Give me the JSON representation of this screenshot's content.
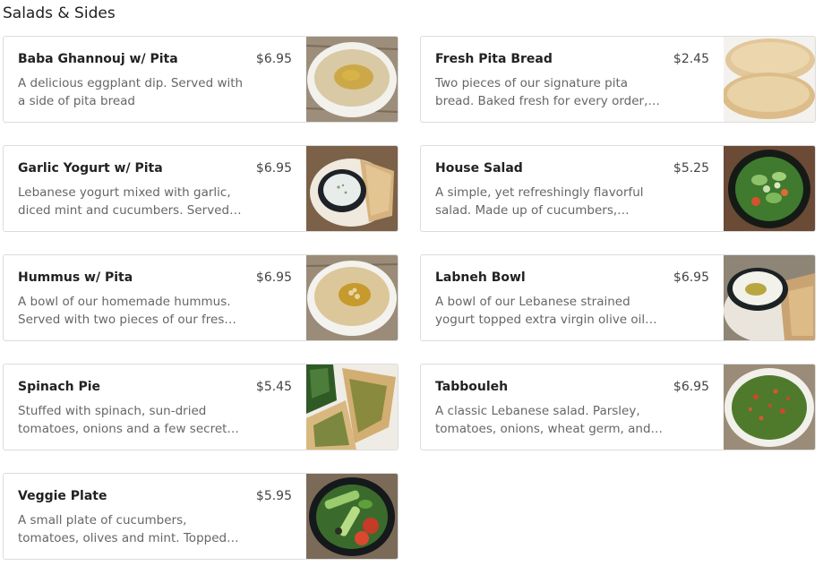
{
  "section": {
    "title": "Salads & Sides"
  },
  "items": [
    {
      "name": "Baba Ghannouj w/ Pita",
      "price": "$6.95",
      "desc": "A delicious eggplant dip. Served with a side of pita bread",
      "photo": "baba-ghannouj-photo"
    },
    {
      "name": "Fresh Pita Bread",
      "price": "$2.45",
      "desc": "Two pieces of our signature pita bread. Baked fresh for every order,…",
      "photo": "pita-bread-photo"
    },
    {
      "name": "Garlic Yogurt w/ Pita",
      "price": "$6.95",
      "desc": "Lebanese yogurt mixed with garlic, diced mint and cucumbers. Served…",
      "photo": "garlic-yogurt-photo"
    },
    {
      "name": "House Salad",
      "price": "$5.25",
      "desc": "A simple, yet refreshingly flavorful salad. Made up of cucumbers,…",
      "photo": "house-salad-photo"
    },
    {
      "name": "Hummus w/ Pita",
      "price": "$6.95",
      "desc": "A bowl of our homemade hummus. Served with two pieces of our fres…",
      "photo": "hummus-photo"
    },
    {
      "name": "Labneh Bowl",
      "price": "$6.95",
      "desc": "A bowl of our Lebanese strained yogurt topped extra virgin olive oil…",
      "photo": "labneh-photo"
    },
    {
      "name": "Spinach Pie",
      "price": "$5.45",
      "desc": "Stuffed with spinach, sun-dried tomatoes, onions and a few secret…",
      "photo": "spinach-pie-photo"
    },
    {
      "name": "Tabbouleh",
      "price": "$6.95",
      "desc": "A classic Lebanese salad. Parsley, tomatoes, onions, wheat germ, and our…",
      "photo": "tabbouleh-photo"
    },
    {
      "name": "Veggie Plate",
      "price": "$5.95",
      "desc": "A small plate of cucumbers, tomatoes, olives and mint. Topped…",
      "photo": "veggie-plate-photo"
    }
  ]
}
